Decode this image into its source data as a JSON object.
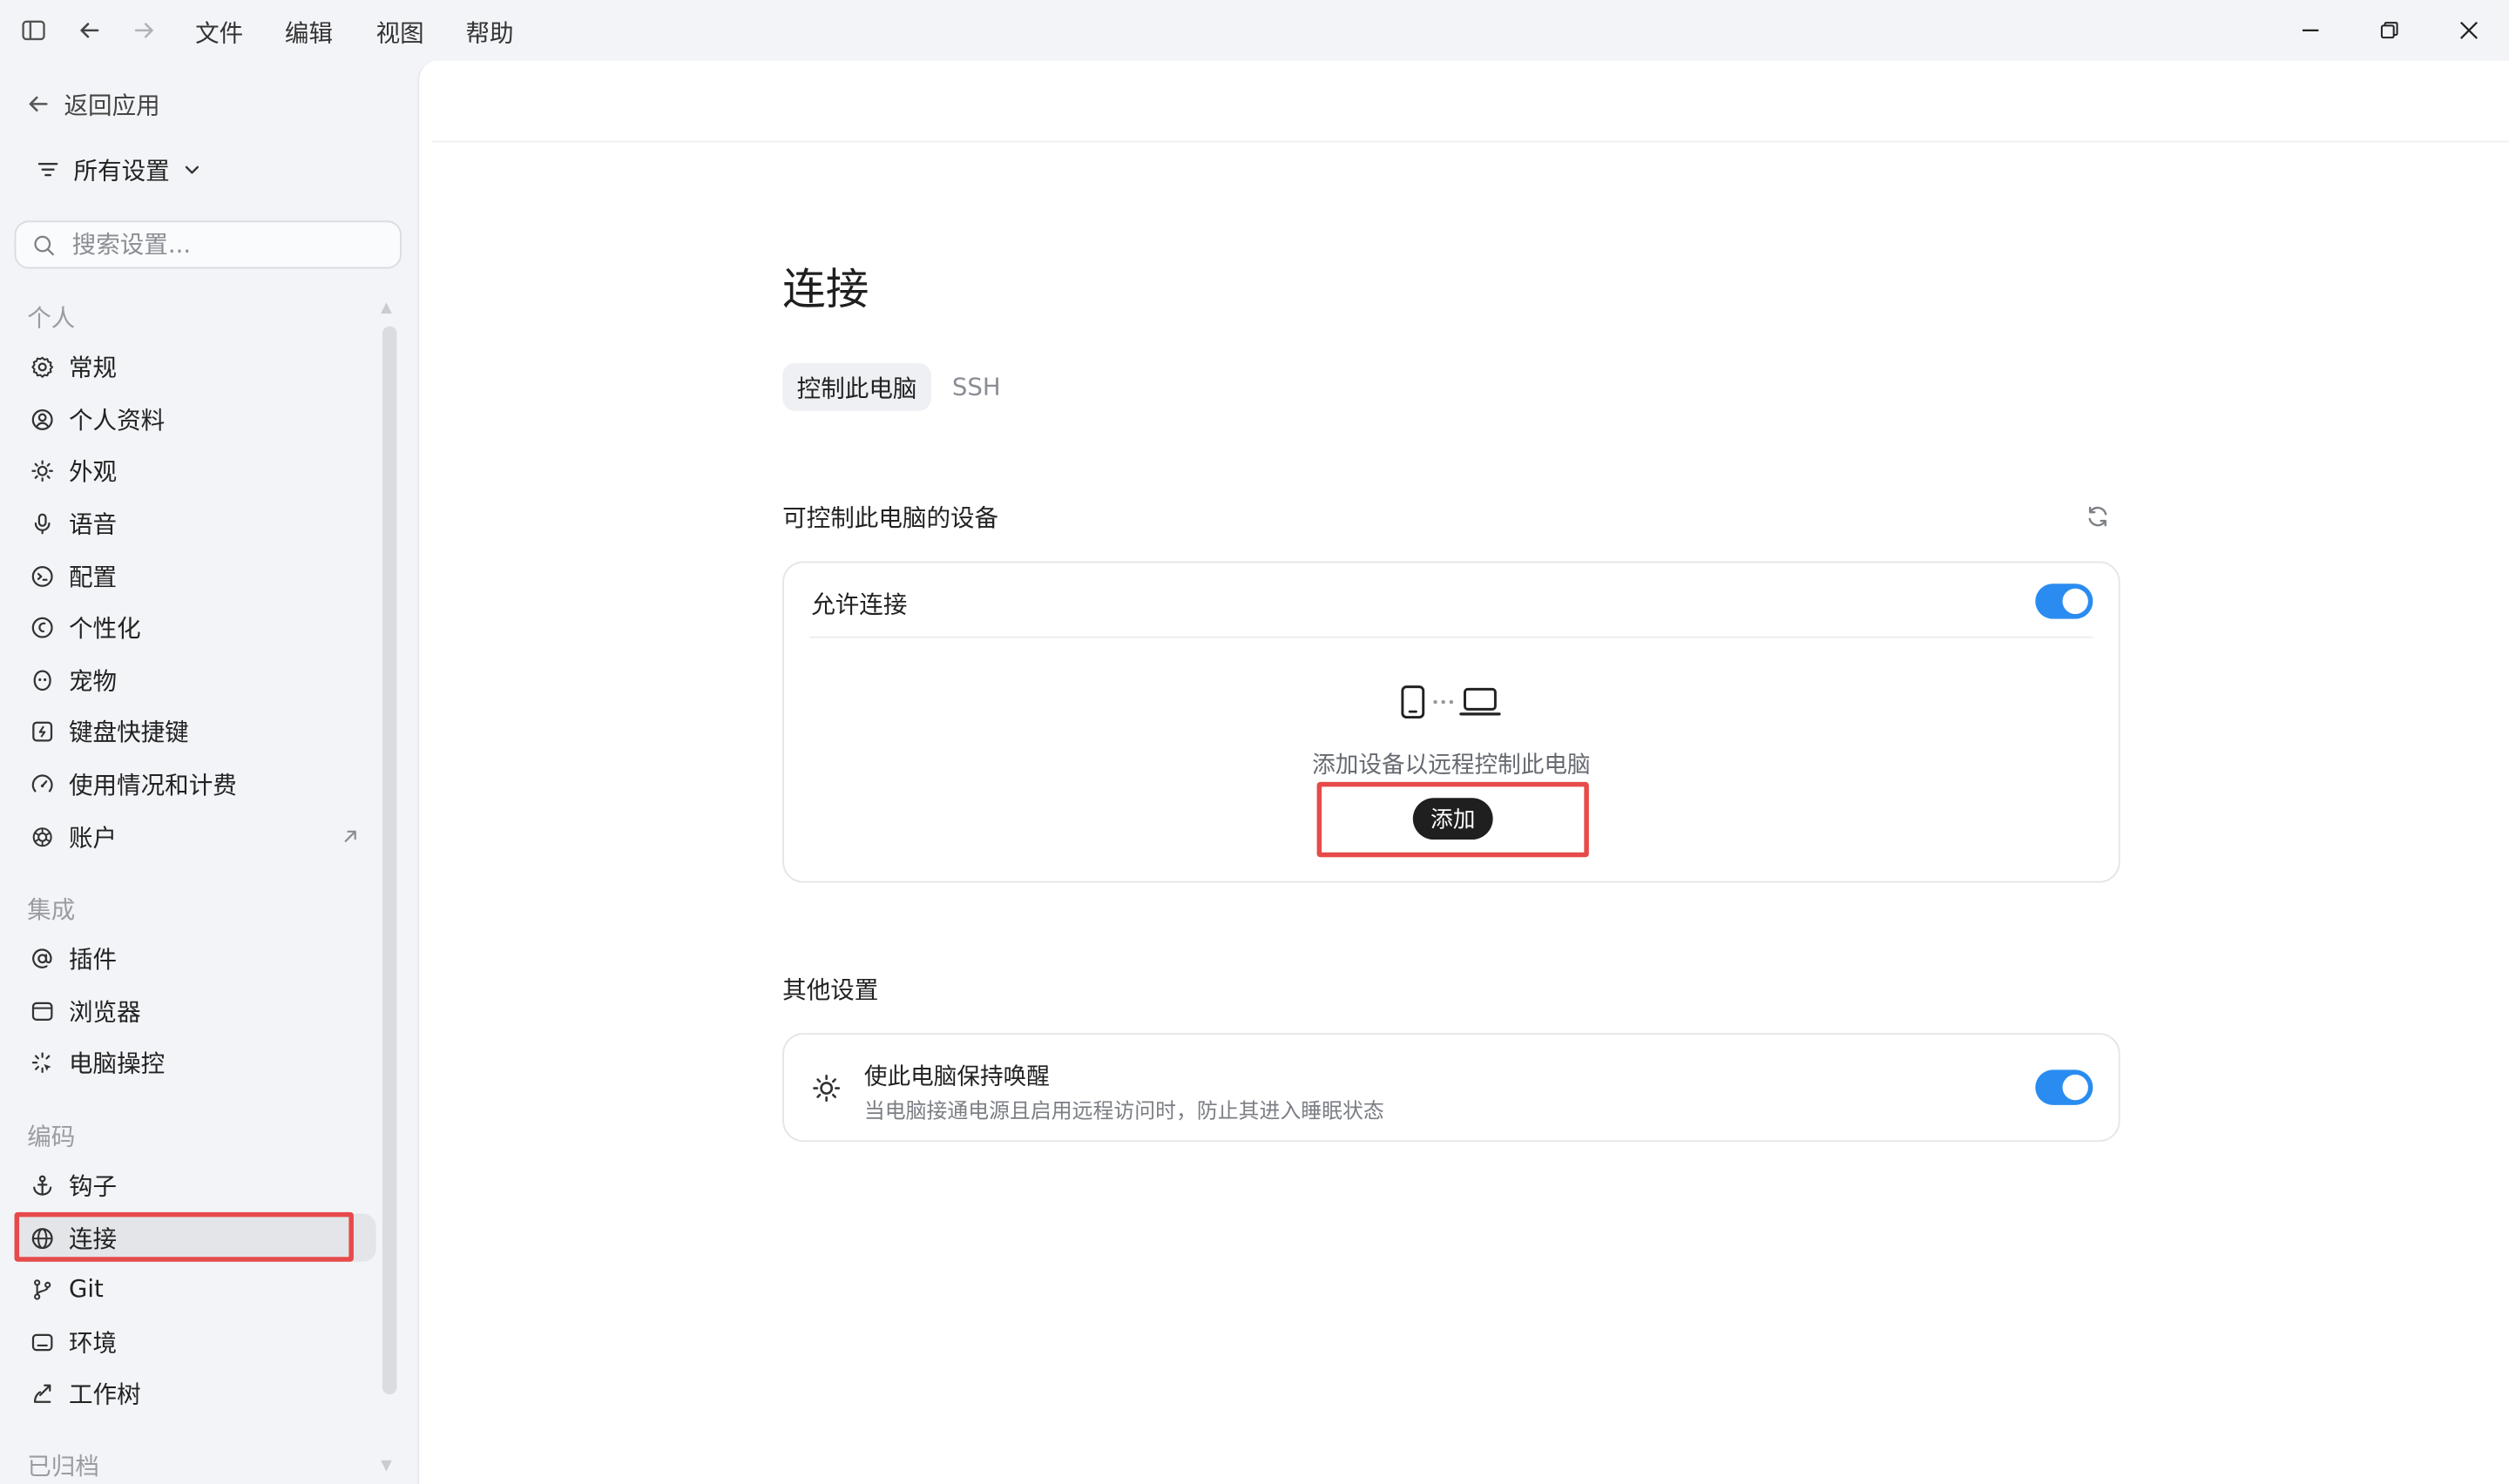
{
  "titlebar": {
    "menu": [
      "文件",
      "编辑",
      "视图",
      "帮助"
    ]
  },
  "sidebar": {
    "back_label": "返回应用",
    "filter_label": "所有设置",
    "search_placeholder": "搜索设置...",
    "sections": {
      "personal": "个人",
      "integrations": "集成",
      "coding": "编码",
      "archived": "已归档"
    },
    "personal_items": [
      {
        "label": "常规",
        "icon": "gear-icon"
      },
      {
        "label": "个人资料",
        "icon": "user-circle-icon"
      },
      {
        "label": "外观",
        "icon": "sun-icon"
      },
      {
        "label": "语音",
        "icon": "microphone-icon"
      },
      {
        "label": "配置",
        "icon": "config-icon"
      },
      {
        "label": "个性化",
        "icon": "smile-icon"
      },
      {
        "label": "宠物",
        "icon": "pet-icon"
      },
      {
        "label": "键盘快捷键",
        "icon": "keyboard-icon"
      },
      {
        "label": "使用情况和计费",
        "icon": "gauge-icon"
      },
      {
        "label": "账户",
        "icon": "openai-icon"
      }
    ],
    "integration_items": [
      {
        "label": "插件",
        "icon": "at-icon"
      },
      {
        "label": "浏览器",
        "icon": "browser-icon"
      },
      {
        "label": "电脑操控",
        "icon": "cursor-sparkle-icon"
      }
    ],
    "coding_items": [
      {
        "label": "钩子",
        "icon": "anchor-icon"
      },
      {
        "label": "连接",
        "icon": "globe-icon",
        "active": true
      },
      {
        "label": "Git",
        "icon": "git-branch-icon"
      },
      {
        "label": "环境",
        "icon": "terminal-icon"
      },
      {
        "label": "工作树",
        "icon": "worktree-icon"
      }
    ]
  },
  "main": {
    "title": "连接",
    "tabs": [
      {
        "label": "控制此电脑",
        "active": true
      },
      {
        "label": "SSH",
        "active": false
      }
    ],
    "devices_section_title": "可控制此电脑的设备",
    "allow_connection_label": "允许连接",
    "allow_connection_on": true,
    "empty_text": "添加设备以远程控制此电脑",
    "add_button_label": "添加",
    "other_section_title": "其他设置",
    "keep_awake_title": "使此电脑保持唤醒",
    "keep_awake_desc": "当电脑接通电源且启用远程访问时，防止其进入睡眠状态",
    "keep_awake_on": true
  },
  "colors": {
    "accent": "#2a8cf0",
    "highlight": "#e64a4a",
    "sidebar_bg": "#f3f4f7"
  }
}
